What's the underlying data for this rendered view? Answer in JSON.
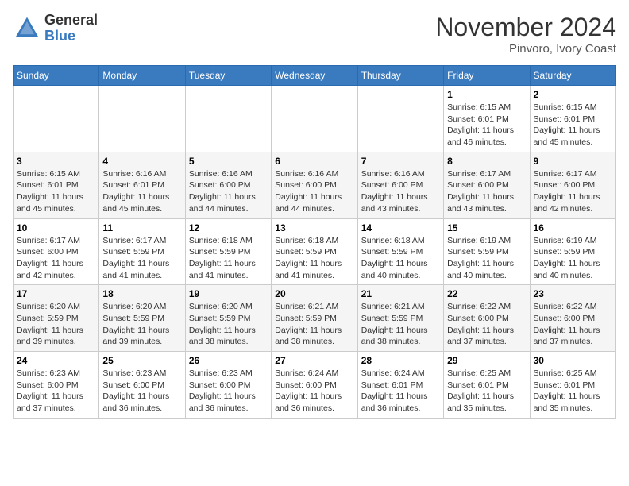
{
  "header": {
    "logo": {
      "general": "General",
      "blue": "Blue"
    },
    "title": "November 2024",
    "location": "Pinvoro, Ivory Coast"
  },
  "days_of_week": [
    "Sunday",
    "Monday",
    "Tuesday",
    "Wednesday",
    "Thursday",
    "Friday",
    "Saturday"
  ],
  "weeks": [
    {
      "days": [
        {
          "num": "",
          "info": ""
        },
        {
          "num": "",
          "info": ""
        },
        {
          "num": "",
          "info": ""
        },
        {
          "num": "",
          "info": ""
        },
        {
          "num": "",
          "info": ""
        },
        {
          "num": "1",
          "info": "Sunrise: 6:15 AM\nSunset: 6:01 PM\nDaylight: 11 hours and 46 minutes."
        },
        {
          "num": "2",
          "info": "Sunrise: 6:15 AM\nSunset: 6:01 PM\nDaylight: 11 hours and 45 minutes."
        }
      ]
    },
    {
      "days": [
        {
          "num": "3",
          "info": "Sunrise: 6:15 AM\nSunset: 6:01 PM\nDaylight: 11 hours and 45 minutes."
        },
        {
          "num": "4",
          "info": "Sunrise: 6:16 AM\nSunset: 6:01 PM\nDaylight: 11 hours and 45 minutes."
        },
        {
          "num": "5",
          "info": "Sunrise: 6:16 AM\nSunset: 6:00 PM\nDaylight: 11 hours and 44 minutes."
        },
        {
          "num": "6",
          "info": "Sunrise: 6:16 AM\nSunset: 6:00 PM\nDaylight: 11 hours and 44 minutes."
        },
        {
          "num": "7",
          "info": "Sunrise: 6:16 AM\nSunset: 6:00 PM\nDaylight: 11 hours and 43 minutes."
        },
        {
          "num": "8",
          "info": "Sunrise: 6:17 AM\nSunset: 6:00 PM\nDaylight: 11 hours and 43 minutes."
        },
        {
          "num": "9",
          "info": "Sunrise: 6:17 AM\nSunset: 6:00 PM\nDaylight: 11 hours and 42 minutes."
        }
      ]
    },
    {
      "days": [
        {
          "num": "10",
          "info": "Sunrise: 6:17 AM\nSunset: 6:00 PM\nDaylight: 11 hours and 42 minutes."
        },
        {
          "num": "11",
          "info": "Sunrise: 6:17 AM\nSunset: 5:59 PM\nDaylight: 11 hours and 41 minutes."
        },
        {
          "num": "12",
          "info": "Sunrise: 6:18 AM\nSunset: 5:59 PM\nDaylight: 11 hours and 41 minutes."
        },
        {
          "num": "13",
          "info": "Sunrise: 6:18 AM\nSunset: 5:59 PM\nDaylight: 11 hours and 41 minutes."
        },
        {
          "num": "14",
          "info": "Sunrise: 6:18 AM\nSunset: 5:59 PM\nDaylight: 11 hours and 40 minutes."
        },
        {
          "num": "15",
          "info": "Sunrise: 6:19 AM\nSunset: 5:59 PM\nDaylight: 11 hours and 40 minutes."
        },
        {
          "num": "16",
          "info": "Sunrise: 6:19 AM\nSunset: 5:59 PM\nDaylight: 11 hours and 40 minutes."
        }
      ]
    },
    {
      "days": [
        {
          "num": "17",
          "info": "Sunrise: 6:20 AM\nSunset: 5:59 PM\nDaylight: 11 hours and 39 minutes."
        },
        {
          "num": "18",
          "info": "Sunrise: 6:20 AM\nSunset: 5:59 PM\nDaylight: 11 hours and 39 minutes."
        },
        {
          "num": "19",
          "info": "Sunrise: 6:20 AM\nSunset: 5:59 PM\nDaylight: 11 hours and 38 minutes."
        },
        {
          "num": "20",
          "info": "Sunrise: 6:21 AM\nSunset: 5:59 PM\nDaylight: 11 hours and 38 minutes."
        },
        {
          "num": "21",
          "info": "Sunrise: 6:21 AM\nSunset: 5:59 PM\nDaylight: 11 hours and 38 minutes."
        },
        {
          "num": "22",
          "info": "Sunrise: 6:22 AM\nSunset: 6:00 PM\nDaylight: 11 hours and 37 minutes."
        },
        {
          "num": "23",
          "info": "Sunrise: 6:22 AM\nSunset: 6:00 PM\nDaylight: 11 hours and 37 minutes."
        }
      ]
    },
    {
      "days": [
        {
          "num": "24",
          "info": "Sunrise: 6:23 AM\nSunset: 6:00 PM\nDaylight: 11 hours and 37 minutes."
        },
        {
          "num": "25",
          "info": "Sunrise: 6:23 AM\nSunset: 6:00 PM\nDaylight: 11 hours and 36 minutes."
        },
        {
          "num": "26",
          "info": "Sunrise: 6:23 AM\nSunset: 6:00 PM\nDaylight: 11 hours and 36 minutes."
        },
        {
          "num": "27",
          "info": "Sunrise: 6:24 AM\nSunset: 6:00 PM\nDaylight: 11 hours and 36 minutes."
        },
        {
          "num": "28",
          "info": "Sunrise: 6:24 AM\nSunset: 6:01 PM\nDaylight: 11 hours and 36 minutes."
        },
        {
          "num": "29",
          "info": "Sunrise: 6:25 AM\nSunset: 6:01 PM\nDaylight: 11 hours and 35 minutes."
        },
        {
          "num": "30",
          "info": "Sunrise: 6:25 AM\nSunset: 6:01 PM\nDaylight: 11 hours and 35 minutes."
        }
      ]
    }
  ]
}
